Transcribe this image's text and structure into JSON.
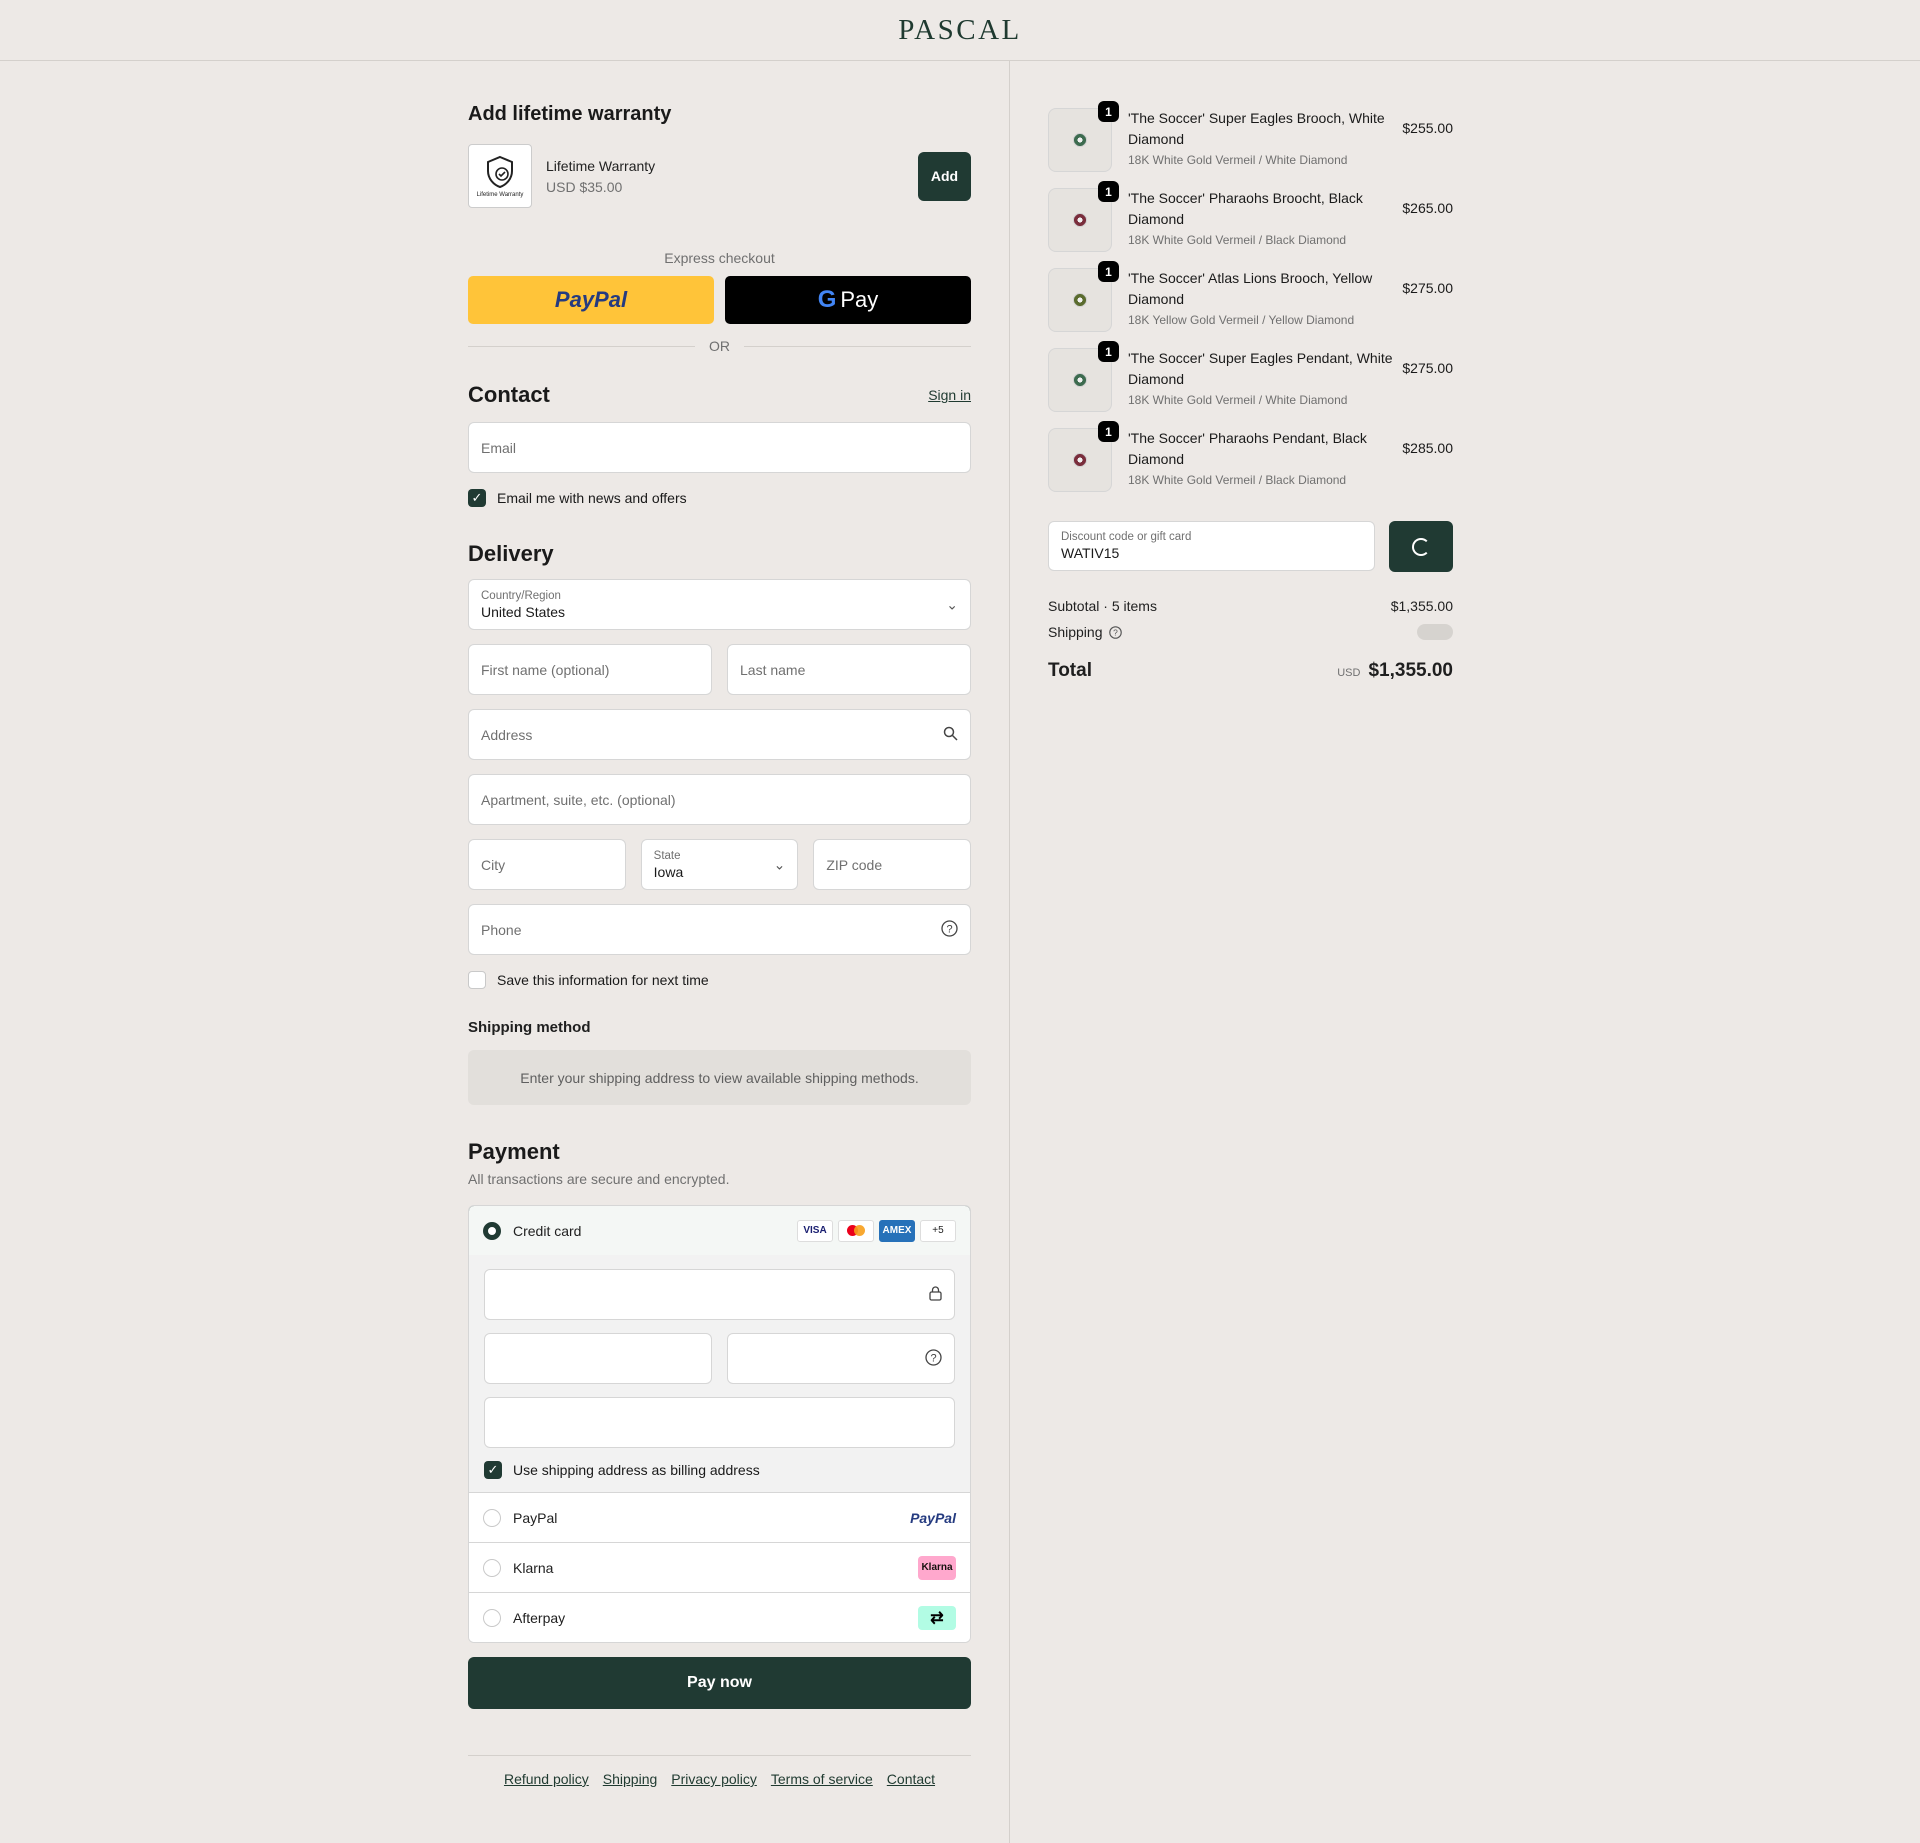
{
  "header": {
    "logo": "PASCAL"
  },
  "warranty": {
    "title": "Add lifetime warranty",
    "thumb_caption": "Lifetime Warranty",
    "name": "Lifetime Warranty",
    "price": "USD $35.00",
    "add_label": "Add"
  },
  "express": {
    "label": "Express checkout",
    "paypal_label": "PayPal",
    "gpay_label": "Pay",
    "or_label": "OR"
  },
  "contact": {
    "title": "Contact",
    "sign_in": "Sign in",
    "email_placeholder": "Email",
    "news_label": "Email me with news and offers"
  },
  "delivery": {
    "title": "Delivery",
    "country_label": "Country/Region",
    "country_value": "United States",
    "first_name_placeholder": "First name (optional)",
    "last_name_placeholder": "Last name",
    "address_placeholder": "Address",
    "apartment_placeholder": "Apartment, suite, etc. (optional)",
    "city_placeholder": "City",
    "state_label": "State",
    "state_value": "Iowa",
    "zip_placeholder": "ZIP code",
    "phone_placeholder": "Phone",
    "save_label": "Save this information for next time"
  },
  "shipping_method": {
    "title": "Shipping method",
    "message": "Enter your shipping address to view available shipping methods."
  },
  "payment": {
    "title": "Payment",
    "subtitle": "All transactions are secure and encrypted.",
    "credit_card_label": "Credit card",
    "cards": [
      "VISA",
      "MC",
      "AMEX",
      "+5"
    ],
    "billing_label": "Use shipping address as billing address",
    "paypal_label": "PayPal",
    "paypal_badge": "PayPal",
    "klarna_label": "Klarna",
    "klarna_badge": "Klarna",
    "afterpay_label": "Afterpay",
    "afterpay_badge": "⇄",
    "pay_button": "Pay now"
  },
  "footer": {
    "links": [
      "Refund policy",
      "Shipping",
      "Privacy policy",
      "Terms of service",
      "Contact"
    ]
  },
  "cart": {
    "items": [
      {
        "qty": "1",
        "name": "'The Soccer' Super Eagles Brooch, White Diamond",
        "variant": "18K White Gold Vermeil / White Diamond",
        "price": "$255.00",
        "gem_color": "#3d6b4f"
      },
      {
        "qty": "1",
        "name": "'The Soccer' Pharaohs Broocht, Black Diamond",
        "variant": "18K White Gold Vermeil / Black Diamond",
        "price": "$265.00",
        "gem_color": "#7a2e3c"
      },
      {
        "qty": "1",
        "name": "'The Soccer' Atlas Lions Brooch, Yellow Diamond",
        "variant": "18K Yellow Gold Vermeil / Yellow Diamond",
        "price": "$275.00",
        "gem_color": "#5a6b2e"
      },
      {
        "qty": "1",
        "name": "'The Soccer' Super Eagles Pendant, White Diamond",
        "variant": "18K White Gold Vermeil / White Diamond",
        "price": "$275.00",
        "gem_color": "#3d6b4f"
      },
      {
        "qty": "1",
        "name": "'The Soccer' Pharaohs Pendant, Black Diamond",
        "variant": "18K White Gold Vermeil / Black Diamond",
        "price": "$285.00",
        "gem_color": "#7a2e3c"
      }
    ],
    "discount_label": "Discount code or gift card",
    "discount_value": "WATIV15",
    "subtotal_label": "Subtotal · 5 items",
    "subtotal_value": "$1,355.00",
    "shipping_label": "Shipping",
    "total_label": "Total",
    "total_currency": "USD",
    "total_value": "$1,355.00"
  },
  "colors": {
    "accent": "#203a33",
    "paypal": "#ffc439",
    "background": "#ede9e6"
  }
}
